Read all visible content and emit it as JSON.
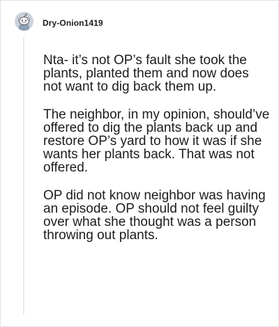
{
  "comment": {
    "author": "Dry-Onion1419",
    "avatar_icon": "reddit-snoo-avatar-icon",
    "paragraphs": [
      "Nta- it’s not OP’s fault she took the plants, planted them and now does not want to dig back them up.",
      "The neighbor, in my opinion, should’ve offered to dig the plants back up and restore OP’s yard to how it was if she wants her plants back. That was not offered.",
      "OP did not know neighbor was having an episode. OP should not feel guilty over what she thought was a person throwing out plants."
    ]
  },
  "colors": {
    "text": "#1c1c1c",
    "thread_line": "#e9e9e9",
    "border": "#e3e3e3",
    "avatar_bg": "#c9d2dc"
  }
}
